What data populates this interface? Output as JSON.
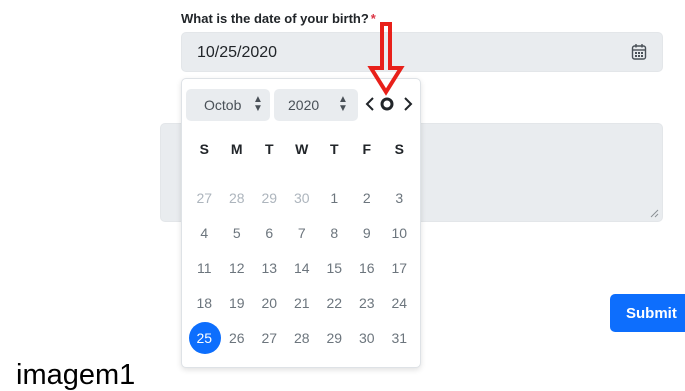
{
  "form": {
    "birth_label": "What is the date of your birth?",
    "required_mark": "*",
    "birth_value": "10/25/2020",
    "submit_label": "Submit"
  },
  "datepicker": {
    "month_value": "Octob",
    "year_value": "2020",
    "weekdays": [
      "S",
      "M",
      "T",
      "W",
      "T",
      "F",
      "S"
    ],
    "selected_day": "25",
    "weeks": [
      [
        "27",
        "28",
        "29",
        "30",
        "1",
        "2",
        "3"
      ],
      [
        "4",
        "5",
        "6",
        "7",
        "8",
        "9",
        "10"
      ],
      [
        "11",
        "12",
        "13",
        "14",
        "15",
        "16",
        "17"
      ],
      [
        "18",
        "19",
        "20",
        "21",
        "22",
        "23",
        "24"
      ],
      [
        "25",
        "26",
        "27",
        "28",
        "29",
        "30",
        "31"
      ]
    ]
  },
  "caption": "imagem1",
  "colors": {
    "accent": "#0d6efd",
    "required": "#dc3545",
    "annotation_arrow": "#e8201a"
  }
}
